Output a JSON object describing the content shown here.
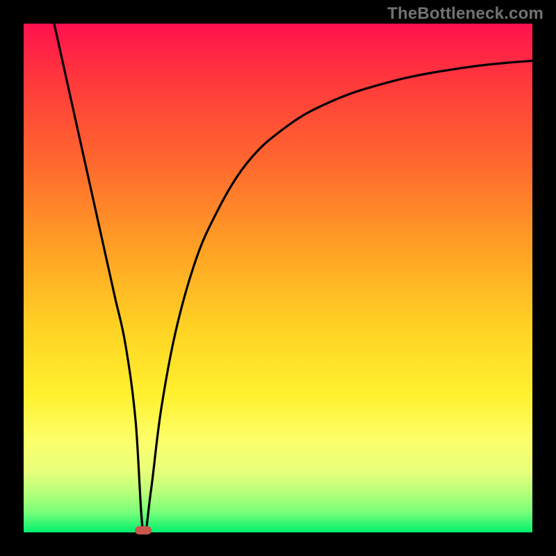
{
  "watermark": "TheBottleneck.com",
  "chart_data": {
    "type": "line",
    "title": "",
    "xlabel": "",
    "ylabel": "",
    "xlim": [
      0,
      100
    ],
    "ylim": [
      0,
      100
    ],
    "grid": false,
    "series": [
      {
        "name": "curve",
        "x": [
          6,
          8,
          10,
          12,
          14,
          16,
          18,
          20,
          22,
          23.5,
          25,
          27,
          30,
          34,
          38,
          42,
          46,
          50,
          55,
          60,
          65,
          70,
          75,
          80,
          85,
          90,
          95,
          100
        ],
        "y": [
          100,
          91,
          82,
          73,
          64,
          55,
          46,
          37,
          22,
          0,
          8,
          24,
          40,
          54,
          63,
          70,
          75,
          78.5,
          82,
          84.5,
          86.5,
          88,
          89.3,
          90.3,
          91.1,
          91.8,
          92.3,
          92.7
        ]
      }
    ],
    "marker": {
      "x": 23.5,
      "y": 0,
      "color": "#c9574b"
    },
    "background_gradient": {
      "orientation": "vertical",
      "stops": [
        {
          "pos": 0.0,
          "color": "#ff114e"
        },
        {
          "pos": 0.12,
          "color": "#ff3b3b"
        },
        {
          "pos": 0.28,
          "color": "#ff6a2e"
        },
        {
          "pos": 0.45,
          "color": "#ffa424"
        },
        {
          "pos": 0.6,
          "color": "#ffd324"
        },
        {
          "pos": 0.73,
          "color": "#fff12f"
        },
        {
          "pos": 0.82,
          "color": "#fdff6b"
        },
        {
          "pos": 0.88,
          "color": "#e8ff7a"
        },
        {
          "pos": 0.92,
          "color": "#b9ff7a"
        },
        {
          "pos": 0.96,
          "color": "#7aff7a"
        },
        {
          "pos": 1.0,
          "color": "#00ef6d"
        }
      ]
    }
  }
}
